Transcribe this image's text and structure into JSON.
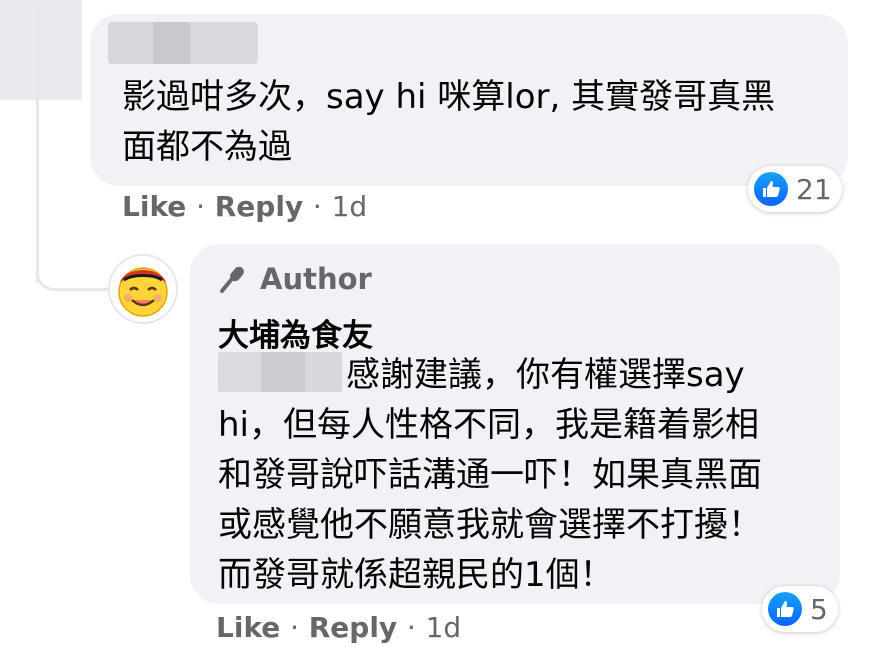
{
  "comment": {
    "text_line1": "影過咁多次，say hi 咪算lor, 其實發哥真黑",
    "text_line2": "面都不為過",
    "actions": {
      "like": "Like",
      "reply": "Reply",
      "separator": "·",
      "time": "1d"
    },
    "reactions": {
      "icon": "like-icon",
      "count": "21"
    }
  },
  "reply": {
    "badge": "Author",
    "author_name": "大埔為食友",
    "text_line1": "感謝建議，你有權選擇say",
    "text_line2": "hi，但每人性格不同，我是籍着影相",
    "text_line3": "和發哥說吓話溝通一吓！如果真黑面",
    "text_line4": "或感覺他不願意我就會選擇不打擾！",
    "text_line5": "而發哥就係超親民的1個！",
    "actions": {
      "like": "Like",
      "reply": "Reply",
      "separator": "·",
      "time": "1d"
    },
    "reactions": {
      "icon": "like-icon",
      "count": "5"
    }
  },
  "colors": {
    "bubble": "#f0f2f5",
    "secondary_text": "#65676b",
    "like_blue": "#0866ff"
  }
}
